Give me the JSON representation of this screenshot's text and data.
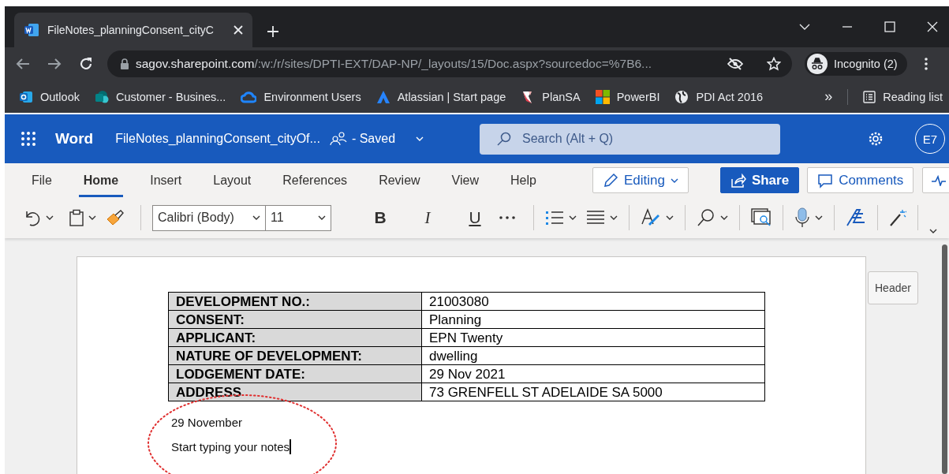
{
  "browser": {
    "tabs": [
      {
        "title": "FileNotes_planningConsent_cityC",
        "selected": true
      }
    ],
    "url_host": "sagov.sharepoint.com",
    "url_path": "/:w:/r/sites/DPTI-EXT/DAP-NP/_layouts/15/Doc.aspx?sourcedoc=%7B6...",
    "profile": "Incognito (2)",
    "bookmarks": [
      {
        "label": "Outlook",
        "kind": "outlook"
      },
      {
        "label": "Customer - Busines...",
        "kind": "sharepoint"
      },
      {
        "label": "Environment Users",
        "kind": "azure"
      },
      {
        "label": "Atlassian | Start page",
        "kind": "atlassian"
      },
      {
        "label": "PlanSA",
        "kind": "plansa"
      },
      {
        "label": "PowerBI",
        "kind": "tiles"
      },
      {
        "label": "PDI Act 2016",
        "kind": "globe"
      }
    ],
    "overflow": "»",
    "reading_list": "Reading list"
  },
  "app": {
    "name": "Word",
    "document_title": "FileNotes_planningConsent_cityOf...",
    "save_status": "- Saved",
    "search": {
      "placeholder": "Search (Alt + Q)"
    },
    "avatar": "E7"
  },
  "ribbon": {
    "tabs": [
      {
        "label": "File",
        "selected": false
      },
      {
        "label": "Home",
        "selected": true
      },
      {
        "label": "Insert",
        "selected": false
      },
      {
        "label": "Layout",
        "selected": false
      },
      {
        "label": "References",
        "selected": false
      },
      {
        "label": "Review",
        "selected": false
      },
      {
        "label": "View",
        "selected": false
      },
      {
        "label": "Help",
        "selected": false
      }
    ],
    "editing": "Editing",
    "share": "Share",
    "comments": "Comments"
  },
  "toolbar": {
    "font": "Calibri (Body)",
    "size": "11",
    "bold": "B",
    "italic": "I",
    "underline": "U"
  },
  "document": {
    "table": {
      "rows": [
        {
          "label": "DEVELOPMENT NO.:",
          "value": "21003080"
        },
        {
          "label": "CONSENT:",
          "value": "Planning"
        },
        {
          "label": "APPLICANT:",
          "value": "EPN Twenty"
        },
        {
          "label": "NATURE OF DEVELOPMENT:",
          "value": "dwelling"
        },
        {
          "label": "LODGEMENT DATE:",
          "value": "29 Nov 2021"
        },
        {
          "label": "ADDRESS",
          "value": "73 GRENFELL ST ADELAIDE SA 5000"
        }
      ]
    },
    "paragraphs": [
      "29 November",
      "Start typing your notes"
    ],
    "header_button": "Header"
  }
}
